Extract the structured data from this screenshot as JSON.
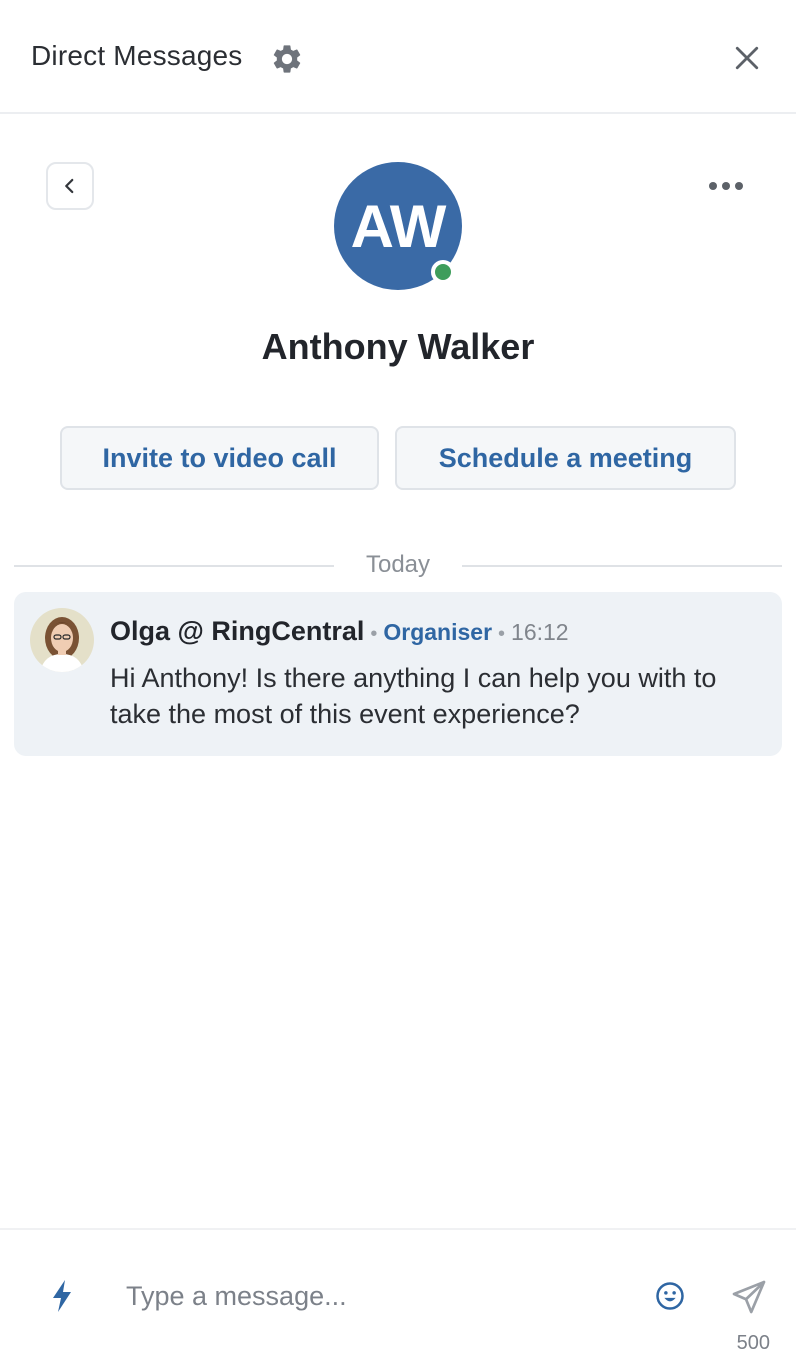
{
  "header": {
    "title": "Direct Messages",
    "settings_icon": "gear-icon",
    "close_icon": "close-icon"
  },
  "profile": {
    "initials": "AW",
    "name": "Anthony Walker",
    "status": "online",
    "avatar_color": "#3a6aa6",
    "presence_color": "#3e9d5b"
  },
  "actions": {
    "video_call_label": "Invite to video call",
    "schedule_meeting_label": "Schedule a meeting"
  },
  "conversation": {
    "day_label": "Today",
    "messages": [
      {
        "author": "Olga @ RingCentral",
        "role": "Organiser",
        "time": "16:12",
        "text": "Hi Anthony! Is there anything I can help you with to take the most of this event experience?"
      }
    ]
  },
  "composer": {
    "placeholder": "Type a message...",
    "char_limit": "500",
    "quick_actions_icon": "lightning-icon",
    "emoji_icon": "emoji-icon",
    "send_icon": "send-icon"
  },
  "colors": {
    "accent": "#2f66a3",
    "message_bg": "#eef2f6"
  }
}
